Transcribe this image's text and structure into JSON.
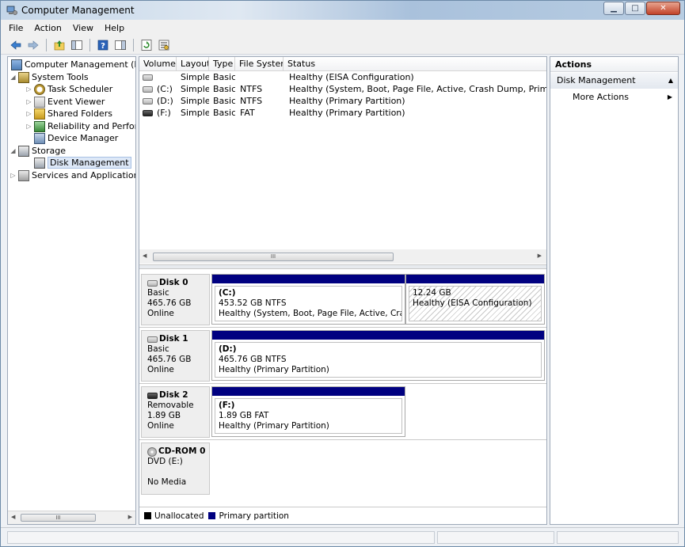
{
  "window": {
    "title": "Computer Management"
  },
  "menu": {
    "file": "File",
    "action": "Action",
    "view": "View",
    "help": "Help"
  },
  "toolbar": {
    "icons": [
      "back-arrow-icon",
      "forward-arrow-icon",
      "up-folder-icon",
      "show-hide-console-tree-icon",
      "help-icon",
      "show-hide-action-pane-icon",
      "refresh-icon",
      "properties-icon"
    ]
  },
  "tree": {
    "root": "Computer Management (Local",
    "system_tools": "System Tools",
    "task_scheduler": "Task Scheduler",
    "event_viewer": "Event Viewer",
    "shared_folders": "Shared Folders",
    "reliability": "Reliability and Performa",
    "device_manager": "Device Manager",
    "storage": "Storage",
    "disk_management": "Disk Management",
    "services": "Services and Applications",
    "scroll_grip": "III"
  },
  "volumes": {
    "headers": [
      "Volume",
      "Layout",
      "Type",
      "File System",
      "Status"
    ],
    "rows": [
      {
        "volume": "",
        "layout": "Simple",
        "type": "Basic",
        "fs": "",
        "status": "Healthy (EISA Configuration)",
        "removable": false
      },
      {
        "volume": "(C:)",
        "layout": "Simple",
        "type": "Basic",
        "fs": "NTFS",
        "status": "Healthy (System, Boot, Page File, Active, Crash Dump, Primary Partition)",
        "removable": false
      },
      {
        "volume": "(D:)",
        "layout": "Simple",
        "type": "Basic",
        "fs": "NTFS",
        "status": "Healthy (Primary Partition)",
        "removable": false
      },
      {
        "volume": "(F:)",
        "layout": "Simple",
        "type": "Basic",
        "fs": "FAT",
        "status": "Healthy (Primary Partition)",
        "removable": true
      }
    ],
    "scroll_grip": "III"
  },
  "disks": [
    {
      "name": "Disk 0",
      "kind": "Basic",
      "size": "465.76 GB",
      "state": "Online",
      "partitions": [
        {
          "name": "(C:)",
          "size": "453.52 GB NTFS",
          "status": "Healthy (System, Boot, Page File, Active, Crash Dur"
        },
        {
          "name": "",
          "size": "12.24 GB",
          "status": "Healthy (EISA Configuration)"
        }
      ]
    },
    {
      "name": "Disk 1",
      "kind": "Basic",
      "size": "465.76 GB",
      "state": "Online",
      "partitions": [
        {
          "name": "(D:)",
          "size": "465.76 GB NTFS",
          "status": "Healthy (Primary Partition)"
        }
      ]
    },
    {
      "name": "Disk 2",
      "kind": "Removable",
      "size": "1.89 GB",
      "state": "Online",
      "partitions": [
        {
          "name": "(F:)",
          "size": "1.89 GB FAT",
          "status": "Healthy (Primary Partition)"
        }
      ]
    },
    {
      "name": "CD-ROM 0",
      "kind": "DVD (E:)",
      "size": "",
      "state": "No Media",
      "partitions": []
    }
  ],
  "legend": {
    "unallocated": "Unallocated",
    "unallocated_color": "#000000",
    "primary": "Primary partition",
    "primary_color": "#000080"
  },
  "actions": {
    "title": "Actions",
    "section": "Disk Management",
    "more": "More Actions"
  }
}
